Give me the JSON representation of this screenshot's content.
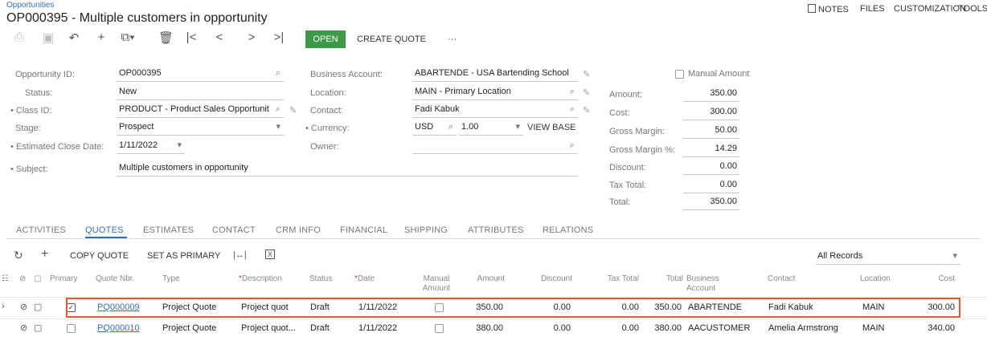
{
  "header": {
    "breadcrumb": "Opportunities",
    "title": "OP000395 - Multiple customers in opportunity",
    "notes": "NOTES",
    "files": "FILES",
    "customization": "CUSTOMIZATION",
    "tools": "TOOLS"
  },
  "toolbar": {
    "open": "OPEN",
    "create_quote": "CREATE QUOTE",
    "more": "···"
  },
  "form": {
    "opportunity_id_label": "Opportunity ID:",
    "opportunity_id": "OP000395",
    "status_label": "Status:",
    "status": "New",
    "class_id_label": "Class ID:",
    "class_id": "PRODUCT - Product Sales Opportunit",
    "stage_label": "Stage:",
    "stage": "Prospect",
    "close_date_label": "Estimated Close Date:",
    "close_date": "1/11/2022",
    "subject_label": "Subject:",
    "subject": "Multiple customers in opportunity",
    "business_account_label": "Business Account:",
    "business_account": "ABARTENDE - USA Bartending School",
    "location_label": "Location:",
    "location": "MAIN - Primary Location",
    "contact_label": "Contact:",
    "contact": "Fadi Kabuk",
    "currency_label": "Currency:",
    "currency": "USD",
    "currency_rate": "1.00",
    "view_base": "VIEW BASE",
    "owner_label": "Owner:",
    "owner": ""
  },
  "summary": {
    "manual_amount_label": "Manual Amount",
    "amount_label": "Amount:",
    "amount": "350.00",
    "cost_label": "Cost:",
    "cost": "300.00",
    "gross_margin_label": "Gross Margin:",
    "gross_margin": "50.00",
    "gross_margin_pct_label": "Gross Margin %:",
    "gross_margin_pct": "14.29",
    "discount_label": "Discount:",
    "discount": "0.00",
    "tax_total_label": "Tax Total:",
    "tax_total": "0.00",
    "total_label": "Total:",
    "total": "350.00"
  },
  "tabs": [
    "ACTIVITIES",
    "QUOTES",
    "ESTIMATES",
    "CONTACT",
    "CRM INFO",
    "FINANCIAL",
    "SHIPPING",
    "ATTRIBUTES",
    "RELATIONS"
  ],
  "grid_toolbar": {
    "copy_quote": "COPY QUOTE",
    "set_as_primary": "SET AS PRIMARY",
    "filter": "All Records"
  },
  "columns": {
    "primary": "Primary",
    "quote_nbr": "Quote Nbr.",
    "type": "Type",
    "description": "Description",
    "status": "Status",
    "date": "Date",
    "manual_amount_1": "Manual",
    "manual_amount_2": "Amount",
    "amount": "Amount",
    "discount": "Discount",
    "tax_total": "Tax Total",
    "total": "Total",
    "business_account_1": "Business",
    "business_account_2": "Account",
    "contact": "Contact",
    "location": "Location",
    "cost": "Cost"
  },
  "rows": [
    {
      "quote_nbr": "PQ000009",
      "type": "Project Quote",
      "description": "Project quot",
      "status": "Draft",
      "date": "1/11/2022",
      "amount": "350.00",
      "discount": "0.00",
      "tax_total": "0.00",
      "total": "350.00",
      "business_account": "ABARTENDE",
      "contact": "Fadi Kabuk",
      "location": "MAIN",
      "cost": "300.00"
    },
    {
      "quote_nbr": "PQ000010",
      "type": "Project Quote",
      "description": "Project quot...",
      "status": "Draft",
      "date": "1/11/2022",
      "amount": "380.00",
      "discount": "0.00",
      "tax_total": "0.00",
      "total": "380.00",
      "business_account": "AACUSTOMER",
      "contact": "Amelia Armstrong",
      "location": "MAIN",
      "cost": "340.00"
    }
  ]
}
